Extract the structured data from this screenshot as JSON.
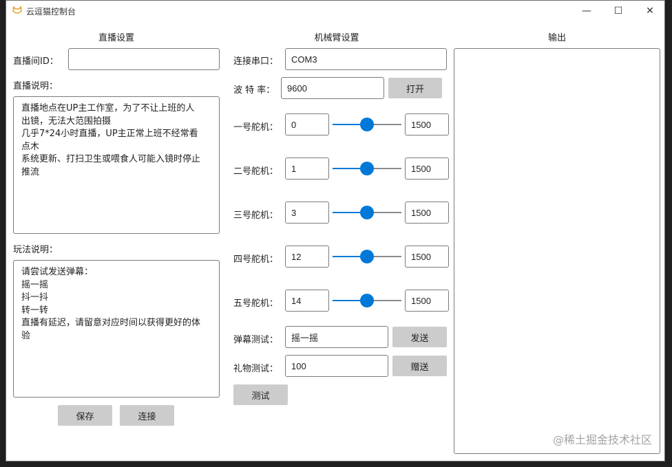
{
  "window": {
    "title": "云逗猫控制台",
    "controls": {
      "minimize": "—",
      "maximize": "☐",
      "close": "✕"
    }
  },
  "live": {
    "title": "直播设置",
    "room_id_label": "直播间ID：",
    "room_id_value": "",
    "desc_label": "直播说明：",
    "desc_text": "直播地点在UP主工作室，为了不让上班的人\n出镜，无法大范围拍摄\n几乎7*24小时直播，UP主正常上班不经常看\n点木\n系统更新、打扫卫生或喂食人可能入镜时停止\n推流",
    "play_label": "玩法说明：",
    "play_text": "请尝试发送弹幕：\n摇一摇\n抖一抖\n转一转\n直播有延迟，请留意对应时间以获得更好的体\n验",
    "save_label": "保存",
    "connect_label": "连接"
  },
  "arm": {
    "title": "机械臂设置",
    "port_label": "连接串口：",
    "port_value": "COM3",
    "baud_label": "波 特 率：",
    "baud_value": "9600",
    "open_label": "打开",
    "servos": [
      {
        "label": "一号舵机：",
        "index": "0",
        "value": "1500",
        "level": 0.5
      },
      {
        "label": "二号舵机：",
        "index": "1",
        "value": "1500",
        "level": 0.5
      },
      {
        "label": "三号舵机：",
        "index": "3",
        "value": "1500",
        "level": 0.5
      },
      {
        "label": "四号舵机：",
        "index": "12",
        "value": "1500",
        "level": 0.5
      },
      {
        "label": "五号舵机：",
        "index": "14",
        "value": "1500",
        "level": 0.5
      }
    ],
    "danmaku_label": "弹幕测试：",
    "danmaku_value": "摇一摇",
    "send_label": "发送",
    "gift_label": "礼物测试：",
    "gift_value": "100",
    "gift_btn_label": "赠送",
    "test_label": "测试"
  },
  "output": {
    "title": "输出"
  },
  "watermark": "@稀土掘金技术社区",
  "colors": {
    "accent": "#0078d7",
    "button": "#cccccc",
    "border": "#7a7a7a"
  }
}
